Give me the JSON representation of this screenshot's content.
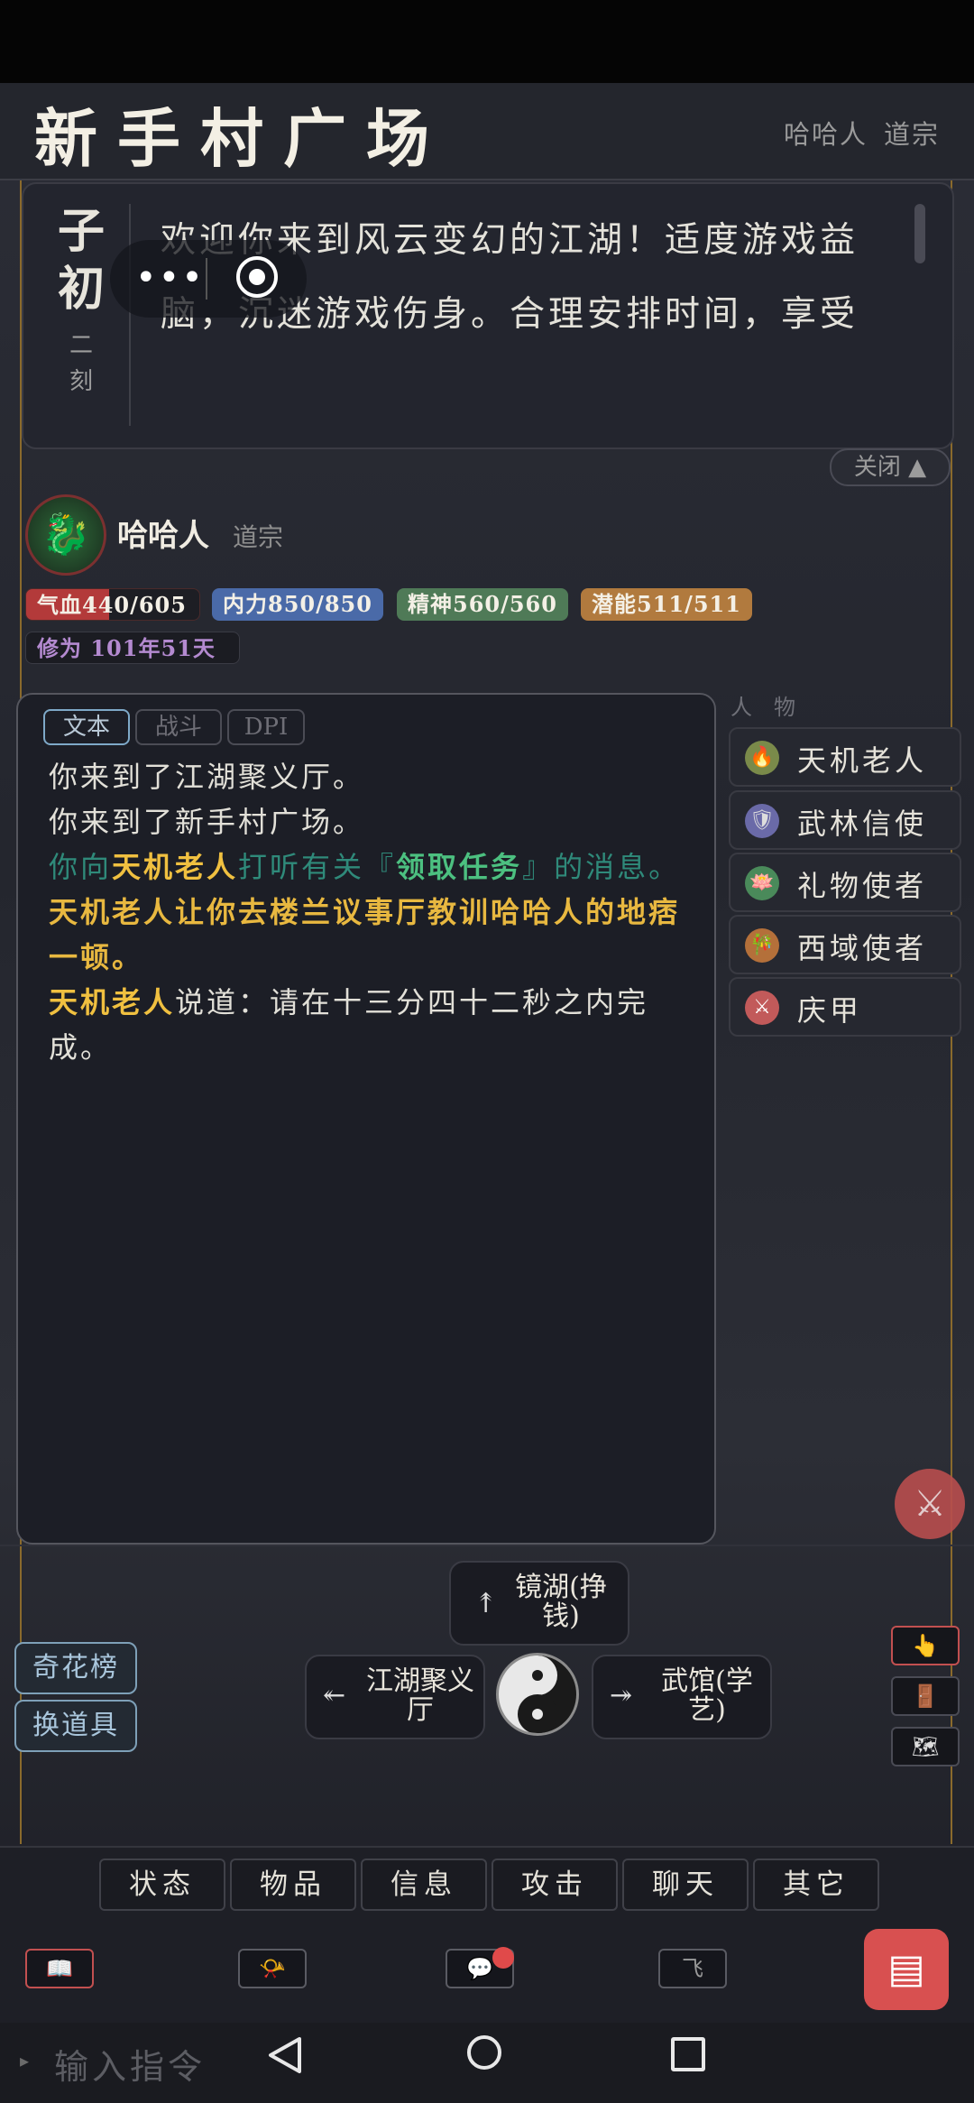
{
  "header": {
    "room_title": "新手村广场",
    "player_name": "哈哈人",
    "sect": "道宗"
  },
  "time": {
    "period": "子初",
    "quarter": "二刻"
  },
  "welcome": "欢迎你来到风云变幻的江湖！适度游戏益脑，沉迷游戏伤身。合理安排时间，享受",
  "close_label": "关闭 ▲",
  "player": {
    "name": "哈哈人",
    "sect": "道宗",
    "avatar_icon": "dragon-icon"
  },
  "stats": {
    "hp": "气血440/605",
    "neili": "内力850/850",
    "jingshen": "精神560/560",
    "qianneng": "潜能511/511",
    "xiuwei": "修为 101年51天",
    "hp_fraction": 0.727
  },
  "tabs": [
    "文本",
    "战斗",
    "DPI"
  ],
  "log": {
    "line1": "你来到了江湖聚义厅。",
    "line2": "你来到了新手村广场。",
    "line3_a": "你向",
    "line3_b": "天机老人",
    "line3_c": "打听有关『",
    "line3_d": "领取任务",
    "line3_e": "』的消息。",
    "line4": "天机老人让你去楼兰议事厅教训哈哈人的地痞一顿。",
    "line5_a": "天机老人",
    "line5_b": "说道：请在十三分四十二秒之内完成。"
  },
  "npc_header": "人物",
  "npcs": [
    {
      "name": "天机老人",
      "icon": "flame-icon",
      "color": "#7a8a4a"
    },
    {
      "name": "武林信使",
      "icon": "shield-icon",
      "color": "#6a6aa8"
    },
    {
      "name": "礼物使者",
      "icon": "lotus-icon",
      "color": "#4a8a5a"
    },
    {
      "name": "西域使者",
      "icon": "bamboo-icon",
      "color": "#b4703a"
    },
    {
      "name": "庆甲",
      "icon": "crossed-swords-icon",
      "color": "#c25a5a"
    }
  ],
  "exits": {
    "north": "镜湖(挣钱)",
    "west": "江湖聚义厅",
    "east": "武馆(学艺)"
  },
  "side_buttons": [
    "奇花榜",
    "换道具"
  ],
  "menu": [
    "状态",
    "物品",
    "信息",
    "攻击",
    "聊天",
    "其它"
  ],
  "tools": {
    "fly_label": "飞"
  },
  "command": {
    "placeholder": "输入指令"
  }
}
